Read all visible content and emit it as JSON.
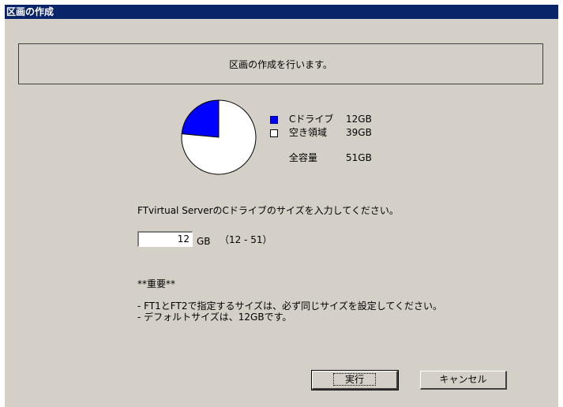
{
  "window": {
    "title": "区画の作成"
  },
  "banner": {
    "text": "区画の作成を行います。"
  },
  "chart_data": {
    "type": "pie",
    "unit": "GB",
    "slices": [
      {
        "label": "Cドライブ",
        "value": 12,
        "color": "#0000ff"
      },
      {
        "label": "空き領域",
        "value": 39,
        "color": "#ffffff"
      }
    ],
    "total_label": "全容量",
    "total": 51
  },
  "legend": [
    {
      "label": "Cドライブ",
      "size": "12GB"
    },
    {
      "label": "空き領域",
      "size": "39GB"
    }
  ],
  "total": {
    "label": "全容量",
    "size": "51GB"
  },
  "prompt": "FTvirtual ServerのCドライブのサイズを入力してください。",
  "size_input": {
    "value": "12",
    "unit": "GB",
    "range": "（12 - 51）"
  },
  "notes": {
    "heading": "**重要**",
    "lines": [
      "- FT1とFT2で指定するサイズは、必ず同じサイズを設定してください。",
      "- デフォルトサイズは、12GBです。"
    ]
  },
  "buttons": {
    "execute": "実行",
    "cancel": "キャンセル"
  }
}
